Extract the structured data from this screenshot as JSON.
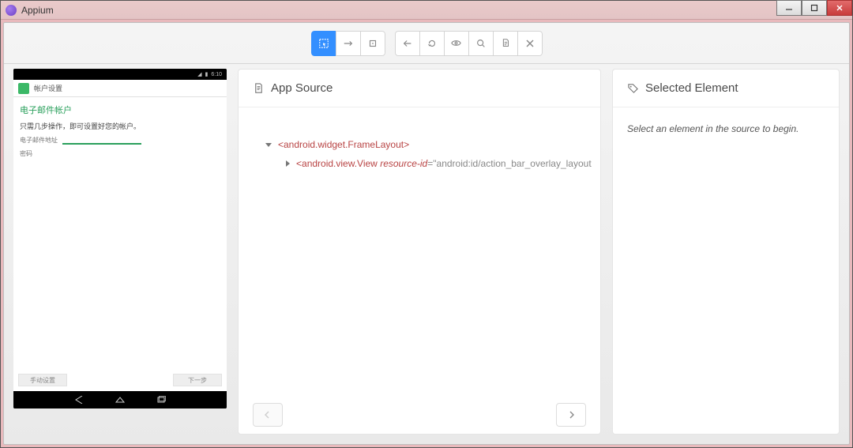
{
  "titlebar": {
    "title": "Appium"
  },
  "toolbar": {
    "groups": {
      "mode": {
        "select_el": "select-element",
        "swipe": "swipe",
        "tap": "tap"
      },
      "actions": {
        "back": "back",
        "refresh": "refresh",
        "record": "recording-eye",
        "search": "search",
        "copy": "copy-xml",
        "close": "close-session"
      }
    }
  },
  "device": {
    "status_time": "6:10",
    "header_label": "帐户设置",
    "screen_title": "电子邮件帐户",
    "screen_desc": "只需几步操作，即可设置好您的帐户。",
    "field_label": "电子邮件地址",
    "field_label2": "密码",
    "btn_left": "手动设置",
    "btn_right": "下一步"
  },
  "source": {
    "title": "App Source",
    "tree": {
      "root_tag": "<android.widget.FrameLayout>",
      "child_prefix": "<",
      "child_tag": "android.view.View",
      "child_attr_name": "resource-id",
      "child_attr_value": "android:id/action_bar_overlay_layout"
    }
  },
  "selected": {
    "title": "Selected Element",
    "placeholder": "Select an element in the source to begin."
  }
}
